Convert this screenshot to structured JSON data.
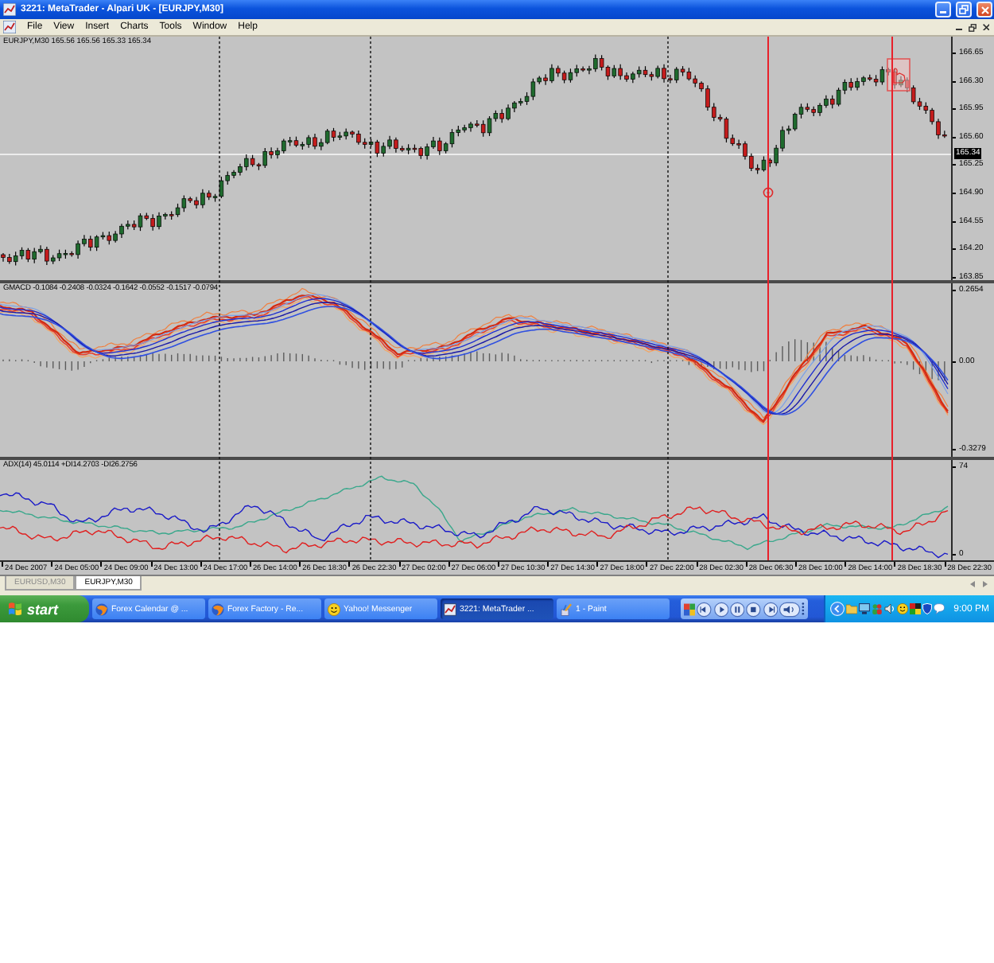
{
  "window": {
    "title": "3221: MetaTrader - Alpari UK - [EURJPY,M30]"
  },
  "menu": [
    "File",
    "View",
    "Insert",
    "Charts",
    "Tools",
    "Window",
    "Help"
  ],
  "chart": {
    "header": "EURJPY,M30 165.56 165.56 165.33 165.34",
    "price_axis": [
      "166.65",
      "166.30",
      "165.95",
      "165.60",
      "165.25",
      "164.90",
      "164.55",
      "164.20",
      "163.85"
    ],
    "current_price": "165.34",
    "indicators": [
      {
        "kind": "macd",
        "label": "GMACD -0.1084 -0.2408 -0.0324 -0.1642 -0.0552 -0.1517 -0.0794",
        "axis": [
          "0.2654",
          "0.00",
          "-0.3279"
        ]
      },
      {
        "kind": "adx",
        "label": "ADX(14) 45.0114 +DI14.2703 -DI26.2756",
        "axis": [
          "74",
          "0"
        ]
      }
    ],
    "time_axis": [
      "24 Dec 2007",
      "24 Dec 05:00",
      "24 Dec 09:00",
      "24 Dec 13:00",
      "24 Dec 17:00",
      "26 Dec 14:00",
      "26 Dec 18:30",
      "26 Dec 22:30",
      "27 Dec 02:00",
      "27 Dec 06:00",
      "27 Dec 10:30",
      "27 Dec 14:30",
      "27 Dec 18:00",
      "27 Dec 22:00",
      "28 Dec 02:30",
      "28 Dec 06:30",
      "28 Dec 10:00",
      "28 Dec 14:00",
      "28 Dec 18:30",
      "28 Dec 22:30"
    ]
  },
  "symbol_tabs": [
    {
      "label": "EURUSD,M30",
      "selected": false
    },
    {
      "label": "EURJPY,M30",
      "selected": true
    }
  ],
  "taskbar": {
    "start": "start",
    "tasks": [
      {
        "kind": "browser",
        "label": "Forex Calendar @ ...",
        "selected": false
      },
      {
        "kind": "browser",
        "label": "Forex Factory - Re...",
        "selected": false
      },
      {
        "kind": "messenger",
        "label": "Yahoo! Messenger",
        "selected": false
      },
      {
        "kind": "trading",
        "label": "3221: MetaTrader ...",
        "selected": true
      },
      {
        "kind": "paint",
        "label": "1 - Paint",
        "selected": false
      }
    ],
    "clock": "9:00 PM"
  }
}
